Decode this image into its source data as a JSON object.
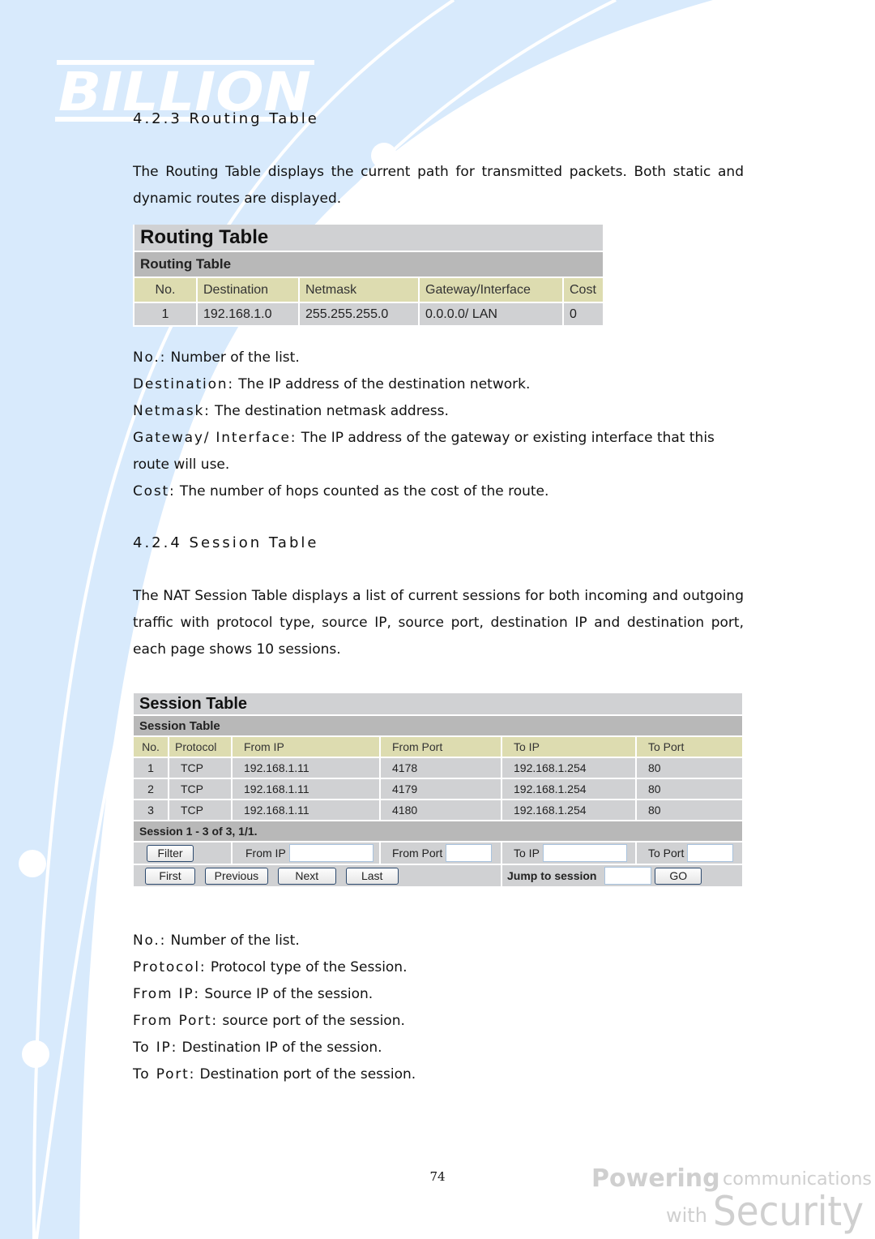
{
  "brand": {
    "logo_text": "BILLION",
    "tagline_line1_bold": "Powering",
    "tagline_line1_rest": "communications",
    "tagline_line2_small": "with",
    "tagline_line2_big": "Security"
  },
  "routing_section": {
    "heading": "4.2.3   Routing Table",
    "intro": "The Routing Table displays the current path for transmitted packets. Both static and dynamic routes are displayed.",
    "ui": {
      "title": "Routing Table",
      "subtitle": "Routing Table",
      "columns": [
        "No.",
        "Destination",
        "Netmask",
        "Gateway/Interface",
        "Cost"
      ],
      "rows": [
        [
          "1",
          "192.168.1.0",
          "255.255.255.0",
          "0.0.0.0/ LAN",
          "0"
        ]
      ]
    },
    "definitions": [
      {
        "term": "No.:",
        "desc": " Number of the list."
      },
      {
        "term": "Destination:",
        "desc": " The IP address of the destination network."
      },
      {
        "term": "Netmask:",
        "desc": " The destination netmask address."
      },
      {
        "term": "Gateway/ Interface:",
        "desc": " The IP address of the gateway or existing interface that this"
      },
      {
        "term": "",
        "desc": "route will use."
      },
      {
        "term": "Cost:",
        "desc": " The number of hops counted as the cost of the route."
      }
    ]
  },
  "session_section": {
    "heading": "4.2.4   Session Table",
    "intro": "The NAT Session Table displays a list of current sessions for both incoming and outgoing traffic with protocol type, source IP, source port, destination IP and destination port, each page shows 10 sessions.",
    "ui": {
      "title": "Session Table",
      "subtitle": "Session Table",
      "columns": [
        "No.",
        "Protocol",
        "From IP",
        "From Port",
        "To IP",
        "To Port"
      ],
      "rows": [
        [
          "1",
          "TCP",
          "192.168.1.11",
          "4178",
          "192.168.1.254",
          "80"
        ],
        [
          "2",
          "TCP",
          "192.168.1.11",
          "4179",
          "192.168.1.254",
          "80"
        ],
        [
          "3",
          "TCP",
          "192.168.1.11",
          "4180",
          "192.168.1.254",
          "80"
        ]
      ],
      "status": "Session 1 - 3 of 3, 1/1.",
      "filter": {
        "button": "Filter",
        "from_ip_label": "From IP",
        "from_ip_value": "",
        "from_port_label": "From Port",
        "from_port_value": "",
        "to_ip_label": "To IP",
        "to_ip_value": "",
        "to_port_label": "To Port",
        "to_port_value": ""
      },
      "nav": {
        "first": "First",
        "previous": "Previous",
        "next": "Next",
        "last": "Last",
        "jump_label": "Jump to session",
        "jump_value": "",
        "go": "GO"
      }
    },
    "definitions": [
      {
        "term": "No.:",
        "desc": " Number of the list."
      },
      {
        "term": "Protocol:",
        "desc": " Protocol type of the Session."
      },
      {
        "term": "From IP:",
        "desc": " Source IP of the session."
      },
      {
        "term": "From Port:",
        "desc": " source port of the session."
      },
      {
        "term": "To IP:",
        "desc": " Destination IP of the session."
      },
      {
        "term": "To Port:",
        "desc": " Destination port of the session."
      }
    ]
  },
  "footer": {
    "page_number": "74"
  }
}
